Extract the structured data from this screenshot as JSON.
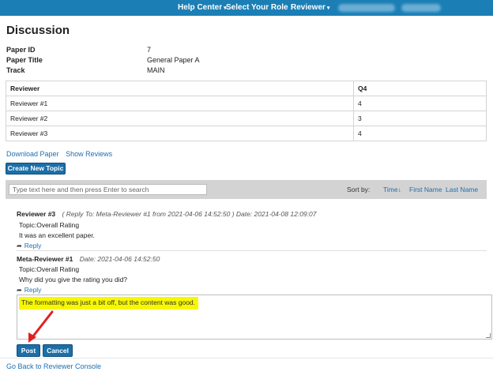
{
  "topbar": {
    "help_center": "Help Center",
    "select_role_label": "Select Your Role :",
    "role": "Reviewer",
    "caret": "▾"
  },
  "page": {
    "title": "Discussion"
  },
  "paper": {
    "id_label": "Paper ID",
    "id_value": "7",
    "title_label": "Paper Title",
    "title_value": "General Paper A",
    "track_label": "Track",
    "track_value": "MAIN"
  },
  "reviews_table": {
    "headers": [
      "Reviewer",
      "Q4"
    ],
    "rows": [
      [
        "Reviewer #1",
        "4"
      ],
      [
        "Reviewer #2",
        "3"
      ],
      [
        "Reviewer #3",
        "4"
      ]
    ]
  },
  "links": {
    "download_paper": "Download Paper",
    "show_reviews": "Show Reviews"
  },
  "buttons": {
    "create_topic": "Create New Topic",
    "post": "Post",
    "cancel": "Cancel"
  },
  "search": {
    "placeholder": "Type text here and then press Enter to search",
    "sort_by": "Sort by:",
    "sort_time": "Time",
    "sort_time_arrow": "↓",
    "sort_first_name": "First Name",
    "sort_last_name": "Last Name"
  },
  "comments": [
    {
      "author": "Reviewer #3",
      "meta": "( Reply To: Meta-Reviewer #1 from 2021-04-06 14:52:50 ) Date: 2021-04-08 12:09:07",
      "topic": "Topic:Overall Rating",
      "text": "It was an excellent paper.",
      "reply": "Reply"
    },
    {
      "author": "Meta-Reviewer #1",
      "meta": "Date: 2021-04-06 14:52:50",
      "topic": "Topic:Overall Rating",
      "text": "Why did you give the rating you did?",
      "reply": "Reply"
    }
  ],
  "reply_box": {
    "value": "The formatting was just a bit off, but the content was good."
  },
  "footer": {
    "back_link": "Go Back to Reviewer Console"
  },
  "colors": {
    "topbar": "#1b7fb5",
    "button": "#1c6fa8",
    "link": "#1f6fb0",
    "highlight": "#f7f700",
    "arrow": "#e02020"
  },
  "icons": {
    "reply": "reply-arrow-icon",
    "sort": "sort-down-arrow-icon",
    "caret": "caret-down-icon"
  }
}
